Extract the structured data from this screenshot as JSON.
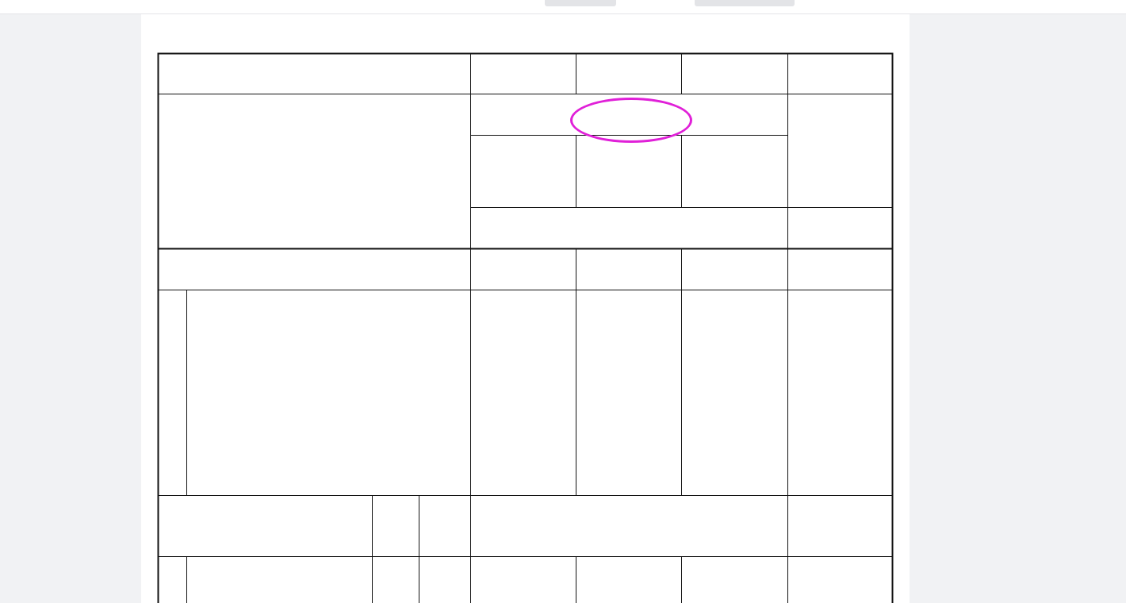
{
  "colors": {
    "annotation_ellipse": "#e020d8",
    "background": "#f1f2f4",
    "page": "#ffffff"
  },
  "header": {
    "work_content_label": "",
    "work_content_1": "",
    "work_content_2": "",
    "unit_label": "",
    "unit_value": ""
  },
  "table": {
    "quota_no_label": "",
    "codes": [],
    "item_label_left": "",
    "item_label_right": "",
    "group_label": "",
    "col_titles": [],
    "col4_title": "",
    "units": [],
    "total_label": "",
    "totals": [],
    "side_top": "",
    "side_bottom": "",
    "breakdown": [],
    "qty_header": {}
  }
}
